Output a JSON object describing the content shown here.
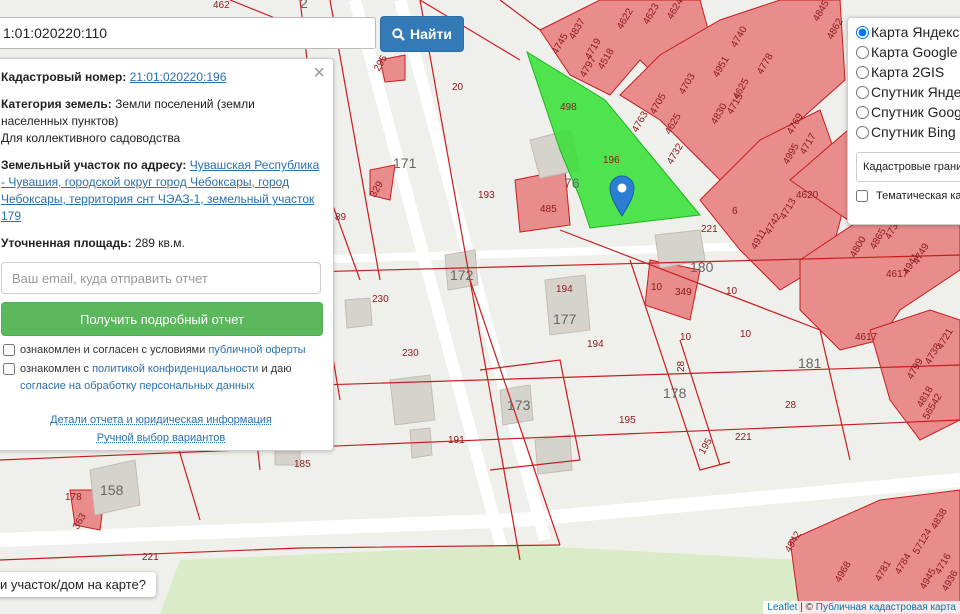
{
  "search": {
    "value": "1:01:020220:110",
    "button_label": "Найти"
  },
  "info": {
    "cadastral_label": "Кадастровый номер:",
    "cadastral_value": "21:01:020220:196",
    "category_label": "Категория земель:",
    "category_value": "Земли поселений (земли населенных пунктов)",
    "category_use": "Для коллективного садоводства",
    "address_label": "Земельный участок по адресу:",
    "address_value": "Чувашская Республика - Чувашия, городской округ город Чебоксары, город Чебоксары, территория снт ЧЭАЗ-1, земельный участок 179",
    "area_label": "Уточненная площадь:",
    "area_value": "289 кв.м.",
    "email_placeholder": "Ваш email, куда отправить отчет",
    "report_button": "Получить подробный отчет",
    "consent1_text": "ознакомлен и согласен с условиями",
    "consent1_link": "публичной оферты",
    "consent2_text": "ознакомлен с",
    "consent2_link": "политикой конфиденциальности",
    "consent2_mid": "и даю",
    "consent2_link2": "согласие на обработку персональных данных",
    "details_link": "Детали отчета и юридическая информация",
    "manual_link": "Ручной выбор вариантов"
  },
  "layers": {
    "options": [
      "Карта Яндекс",
      "Карта Google",
      "Карта 2GIS",
      "Спутник Яндекс",
      "Спутник Google",
      "Спутник Bing"
    ],
    "selected_index": 0,
    "overlay_select": "Кадастровые границы",
    "thematic_label": "Тематическая карта"
  },
  "question": "и участок/дом на карте?",
  "attribution": {
    "leaflet": "Leaflet",
    "separator": " | © ",
    "source": "Публичная кадастровая карта"
  },
  "map_labels": {
    "parcels": [
      "462",
      "4837",
      "4745",
      "4719",
      "4622",
      "4623",
      "4624",
      "4518",
      "4797",
      "4740",
      "4778",
      "4951",
      "4703",
      "4625",
      "4715",
      "4830",
      "4705",
      "4763",
      "4625",
      "4732",
      "4845",
      "4862",
      "4769",
      "4717",
      "4995",
      "4620",
      "4713",
      "4742",
      "4911",
      "4730",
      "4865",
      "4800",
      "4749",
      "4617",
      "4941",
      "4617",
      "4721",
      "4738",
      "4799",
      "4818",
      "56542",
      "4838",
      "57124",
      "4942",
      "4784",
      "4781",
      "4716",
      "4968",
      "4945",
      "4936"
    ],
    "lots": [
      "295",
      "20",
      "171",
      "329",
      "193",
      "485",
      "196",
      "6",
      "221",
      "172",
      "230",
      "194",
      "177",
      "349",
      "10",
      "10",
      "10",
      "10",
      "194",
      "28",
      "181",
      "230",
      "178",
      "28",
      "173",
      "195",
      "221",
      "191",
      "185",
      "178",
      "158",
      "363",
      "221",
      "195",
      "498",
      "89"
    ],
    "buildings": [
      "76",
      "180",
      "2"
    ]
  },
  "colors": {
    "parcel_fill": "#e88c8c",
    "parcel_stroke": "#c81e1e",
    "selected_fill": "#33e033",
    "marker": "#2a7fd4"
  }
}
